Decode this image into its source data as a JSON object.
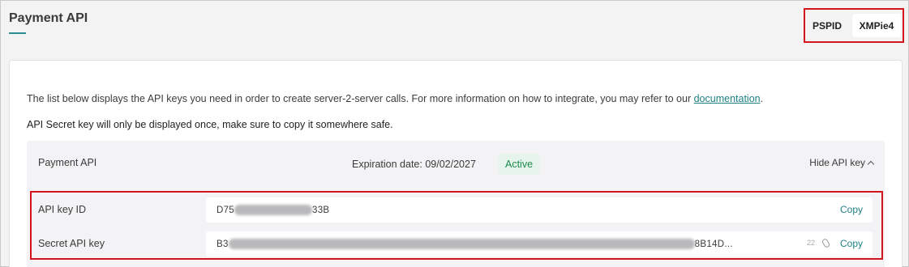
{
  "header": {
    "title": "Payment API",
    "pspid_label": "PSPID",
    "pspid_value": "XMPie4"
  },
  "card": {
    "intro_text": "The list below displays the API keys you need in order to create server-2-server calls. For more information on how to integrate, you may refer to our ",
    "intro_link": "documentation",
    "intro_end": ".",
    "warning_text": "API Secret key will only be displayed once, make sure to copy it somewhere safe."
  },
  "api_panel": {
    "name": "Payment API",
    "expiration": "Expiration date: 09/02/2027",
    "status": "Active",
    "status_color": "#1d8a4d",
    "hide_label": "Hide API key",
    "keys": [
      {
        "label": "API key ID",
        "value_start": "D75",
        "value_end": "33B",
        "copy_label": "Copy"
      },
      {
        "label": "Secret API key",
        "value_start": "B3",
        "value_end": "8B14D...",
        "char_count": "22",
        "copy_label": "Copy"
      }
    ]
  },
  "colors": {
    "accent": "#2a8d91",
    "highlight_border": "#d2141c"
  }
}
